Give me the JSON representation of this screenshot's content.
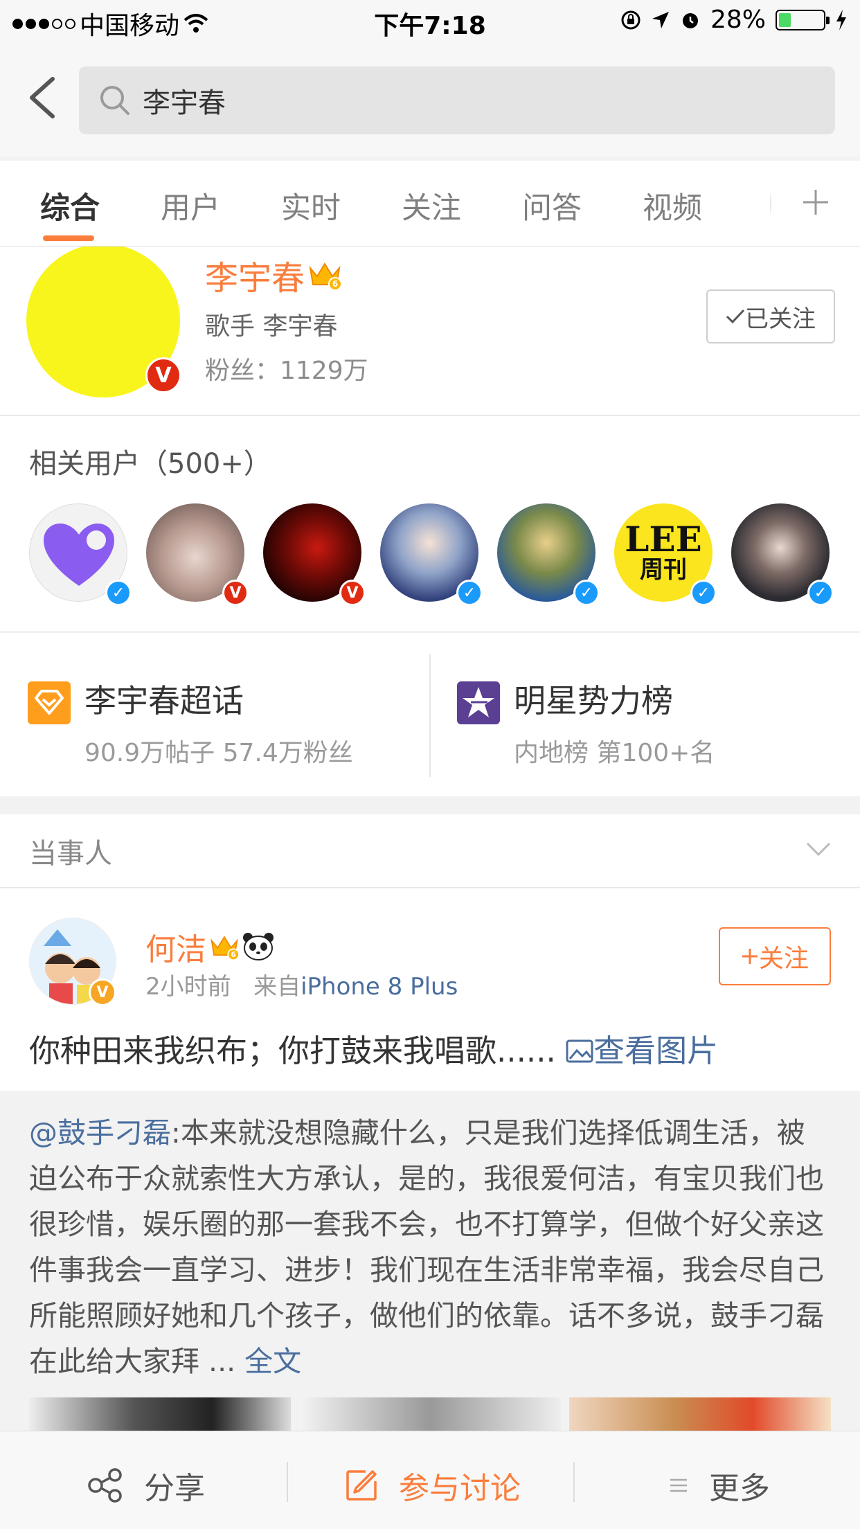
{
  "status_bar": {
    "carrier": "中国移动",
    "time": "下午7:18",
    "battery": "28%"
  },
  "search": {
    "query": "李宇春"
  },
  "tabs": [
    {
      "label": "综合",
      "active": true
    },
    {
      "label": "用户",
      "active": false
    },
    {
      "label": "实时",
      "active": false
    },
    {
      "label": "关注",
      "active": false
    },
    {
      "label": "问答",
      "active": false
    },
    {
      "label": "视频",
      "active": false
    }
  ],
  "profile": {
    "name": "李宇春",
    "crown_level": "6",
    "description": "歌手 李宇春",
    "fans": "粉丝：1129万",
    "follow_label": "已关注",
    "badge": "V"
  },
  "related": {
    "title": "相关用户（500+）",
    "users": [
      {
        "id": "purple-heart",
        "badge": "blue"
      },
      {
        "id": "hands-triangle",
        "badge": "red"
      },
      {
        "id": "red-portrait",
        "badge": "red"
      },
      {
        "id": "blue-hair",
        "badge": "blue"
      },
      {
        "id": "blonde-hair",
        "badge": "blue"
      },
      {
        "id": "lee-weekly",
        "badge": "blue",
        "logo_text": "LEE",
        "logo_sub": "周刊"
      },
      {
        "id": "dark-portrait",
        "badge": "blue"
      }
    ]
  },
  "topics": [
    {
      "title": "李宇春超话",
      "sub": "90.9万帖子  57.4万粉丝",
      "icon": "diamond-icon",
      "color": "#ff9d1c"
    },
    {
      "title": "明星势力榜",
      "sub": "内地榜 第100+名",
      "icon": "star-icon",
      "color": "#5b3f93"
    }
  ],
  "section": {
    "label": "当事人"
  },
  "post": {
    "author": "何洁",
    "crown_level": "6",
    "time": "2小时前",
    "from_prefix": "来自",
    "source": "iPhone 8 Plus",
    "follow_label": "关注",
    "text": "你种田来我织布；你打鼓来我唱歌......",
    "view_pics": "查看图片",
    "repost": {
      "mention": "@鼓手刁磊",
      "body": ":本来就没想隐藏什么，只是我们选择低调生活，被迫公布于众就索性大方承认，是的，我很爱何洁，有宝贝我们也很珍惜，娱乐圈的那一套我不会，也不打算学，但做个好父亲这件事我会一直学习、进步！我们现在生活非常幸福，我会尽自己所能照顾好她和几个孩子，做他们的依靠。话不多说，鼓手刁磊在此给大家拜 ... ",
      "full_text": "全文"
    }
  },
  "bottom_bar": {
    "share": "分享",
    "discuss": "参与讨论",
    "more": "更多"
  },
  "colors": {
    "accent": "#fa7d3c",
    "link": "#4a6e9e",
    "verified_red": "#e02b12",
    "verified_blue": "#1a9bfc"
  }
}
